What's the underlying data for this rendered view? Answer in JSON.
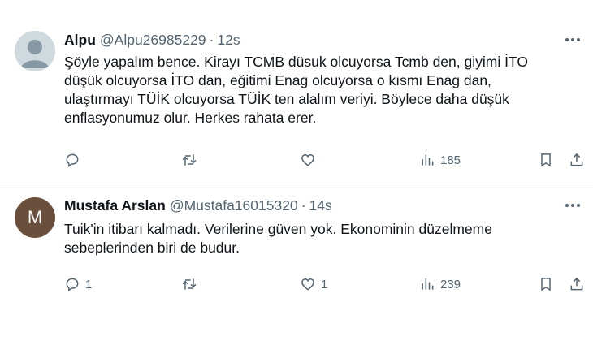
{
  "tweets": [
    {
      "name": "Alpu",
      "handle": "@Alpu26985229",
      "separator": "·",
      "time": "12s",
      "lines": [
        "Şöyle yapalım bence. Kirayı TCMB düsuk olcuyorsa Tcmb den, giyimi İTO",
        "düşük olcuyorsa İTO dan, eğitimi Enag olcuyorsa o kısmı Enag dan,",
        "ulaştırmayı TÜİK olcuyorsa TÜİK ten alalım veriyi. Böylece daha düşük",
        "enflasyonumuz olur. Herkes rahata erer."
      ],
      "avatar": "default-profile-icon",
      "reply_count": "",
      "retweet_count": "",
      "like_count": "",
      "views": "185"
    },
    {
      "name": "Mustafa Arslan",
      "handle": "@Mustafa16015320",
      "separator": "·",
      "time": "14s",
      "lines": [
        "Tuik'in itibarı kalmadı. Verilerine güven yok. Ekonominin düzelmeme",
        "sebeplerinden biri de budur."
      ],
      "avatar_letter": "M",
      "avatar_color": "#6b4f3d",
      "reply_count": "1",
      "retweet_count": "",
      "like_count": "1",
      "views": "239"
    }
  ],
  "icons": [
    "reply-icon",
    "retweet-icon",
    "like-icon",
    "views-icon",
    "bookmark-icon",
    "share-icon",
    "more-icon"
  ]
}
